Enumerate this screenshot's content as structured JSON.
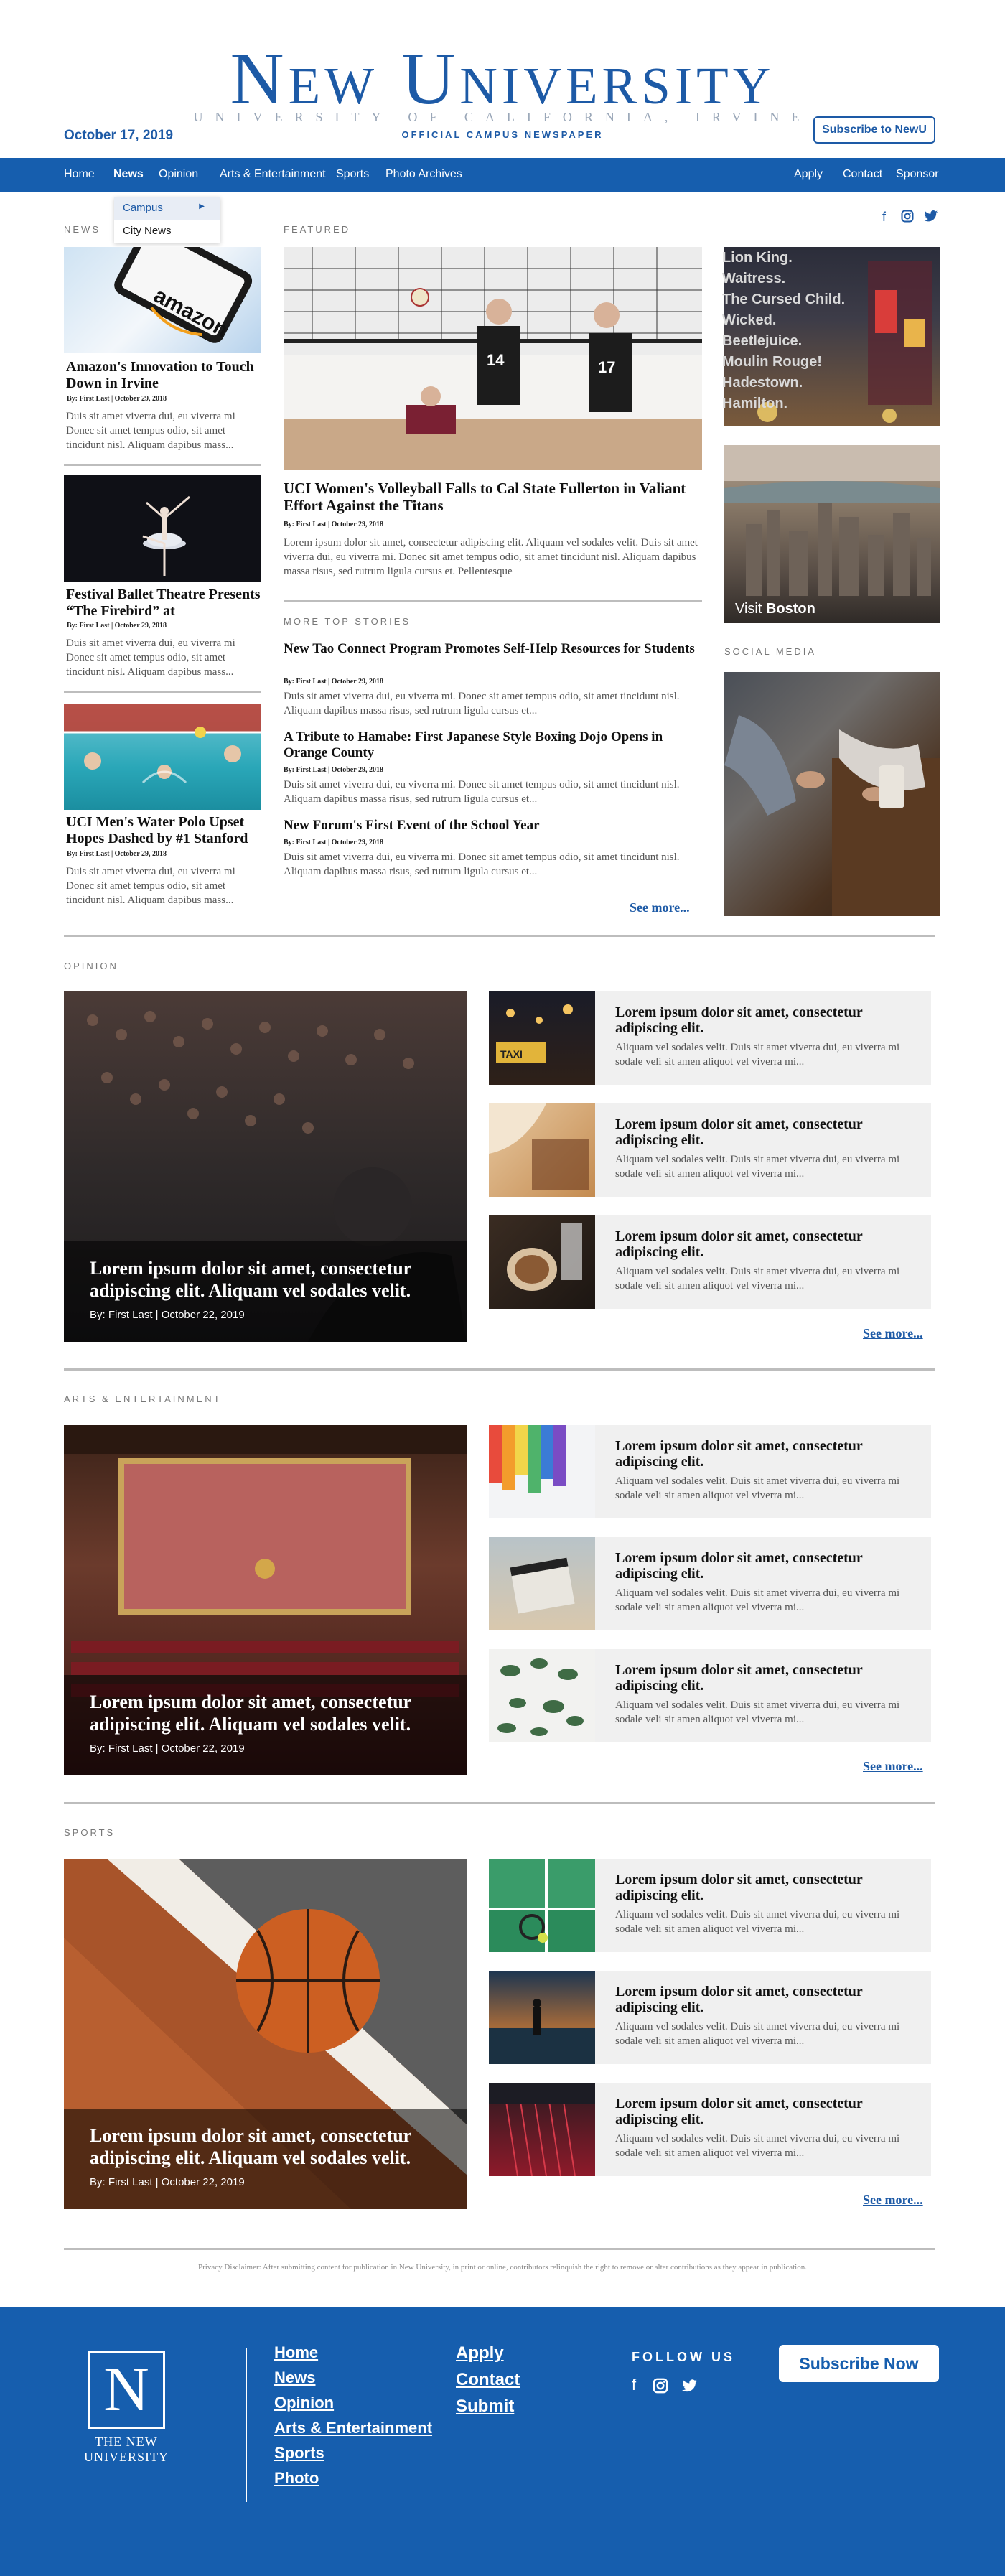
{
  "masthead": {
    "logo": "New University",
    "tagline": "UNIVERSITY OF CALIFORNIA, IRVINE",
    "subtag": "OFFICIAL CAMPUS NEWSPAPER",
    "date": "October 17, 2019",
    "subscribe": "Subscribe to NewU"
  },
  "nav": {
    "left": [
      "Home",
      "News",
      "Opinion",
      "Arts & Entertainment",
      "Sports",
      "Photo Archives"
    ],
    "right": [
      "Apply",
      "Contact",
      "Sponsor"
    ],
    "active": "News",
    "dropdown": [
      "Campus",
      "City News"
    ]
  },
  "social": [
    "facebook-icon",
    "instagram-icon",
    "twitter-icon"
  ],
  "labels": {
    "news": "NEWS",
    "featured": "FEATURED",
    "more_top": "MORE TOP STORIES",
    "social_media": "SOCIAL MEDIA",
    "opinion": "OPINION",
    "arts": "ARTS & ENTERTAINMENT",
    "sports": "SPORTS"
  },
  "news": [
    {
      "title": "Amazon's Innovation to Touch Down in Irvine",
      "byline": "By: First Last | October 29, 2018",
      "excerpt": "Duis sit amet viverra dui, eu viverra mi Donec sit amet tempus odio, sit amet tincidunt nisl. Aliquam dapibus mass..."
    },
    {
      "title": "Festival Ballet Theatre Presents “The Firebird” at",
      "byline": "By: First Last | October 29, 2018",
      "excerpt": "Duis sit amet viverra dui, eu viverra mi Donec sit amet tempus odio, sit amet tincidunt nisl. Aliquam dapibus mass..."
    },
    {
      "title": "UCI Men's Water Polo Upset Hopes Dashed by #1 Stanford",
      "byline": "By: First Last | October 29, 2018",
      "excerpt": "Duis sit amet viverra dui, eu viverra mi Donec sit amet tempus odio, sit amet tincidunt nisl. Aliquam dapibus mass..."
    }
  ],
  "featured": {
    "title": "UCI Women's Volleyball Falls to Cal State Fullerton in Valiant Effort Against the Titans",
    "byline": "By: First Last | October 29, 2018",
    "excerpt": "Lorem ipsum dolor sit amet, consectetur adipiscing elit. Aliquam vel sodales velit. Duis sit amet viverra dui, eu viverra mi. Donec sit amet tempus odio, sit amet tincidunt nisl. Aliquam dapibus massa risus, sed rutrum ligula cursus et. Pellentesque"
  },
  "top_stories": [
    {
      "title": "New Tao Connect Program Promotes Self-Help Resources for Students",
      "byline": "By: First Last | October 29, 2018",
      "excerpt": "Duis sit amet viverra dui, eu viverra mi. Donec sit amet tempus odio, sit amet tincidunt nisl. Aliquam dapibus massa risus, sed rutrum ligula cursus et..."
    },
    {
      "title": "A Tribute to Hamabe: First Japanese Style Boxing Dojo Opens in Orange County",
      "byline": "By: First Last | October 29, 2018",
      "excerpt": "Duis sit amet viverra dui, eu viverra mi. Donec sit amet tempus odio, sit amet tincidunt nisl. Aliquam dapibus massa risus, sed rutrum ligula cursus et..."
    },
    {
      "title": "New Forum's First Event of the School Year",
      "byline": "By: First Last | October 29, 2018",
      "excerpt": "Duis sit amet viverra dui, eu viverra mi. Donec sit amet tempus odio, sit amet tincidunt nisl. Aliquam dapibus massa risus, sed rutrum ligula cursus et..."
    }
  ],
  "see_more": "See more...",
  "sign_text": [
    "Lion King.",
    "Waitress.",
    "The Cursed Child.",
    "Wicked.",
    "Beetlejuice.",
    "Moulin Rouge!",
    "Hadestown.",
    "Hamilton."
  ],
  "visit": {
    "prefix": "Visit",
    "place": "Boston"
  },
  "big_card": {
    "title": "Lorem ipsum dolor sit amet, consectetur adipiscing elit. Aliquam vel sodales velit.",
    "byline": "By: First Last | October 22, 2019"
  },
  "small_card": {
    "title": "Lorem ipsum dolor sit amet, consectetur adipiscing elit.",
    "excerpt": "Aliquam vel sodales velit. Duis sit amet viverra dui, eu viverra mi sodale veli sit amen aliquot vel viverra mi..."
  },
  "disclaimer": "Privacy Disclaimer: After submitting content for publication in New University, in print or online, contributors relinquish the right to remove or alter contributions as they appear in publication.",
  "footer": {
    "logo_text": "THE NEW UNIVERSITY",
    "logo_letter": "N",
    "links_col1": [
      "Home",
      "News",
      "Opinion",
      "Arts & Entertainment",
      "Sports",
      "Photo"
    ],
    "links_col2": [
      "Apply",
      "Contact",
      "Submit"
    ],
    "follow": "FOLLOW US",
    "subscribe": "Subscribe Now"
  },
  "colors": {
    "brand": "#165eae",
    "logo": "#1d5aa6"
  }
}
